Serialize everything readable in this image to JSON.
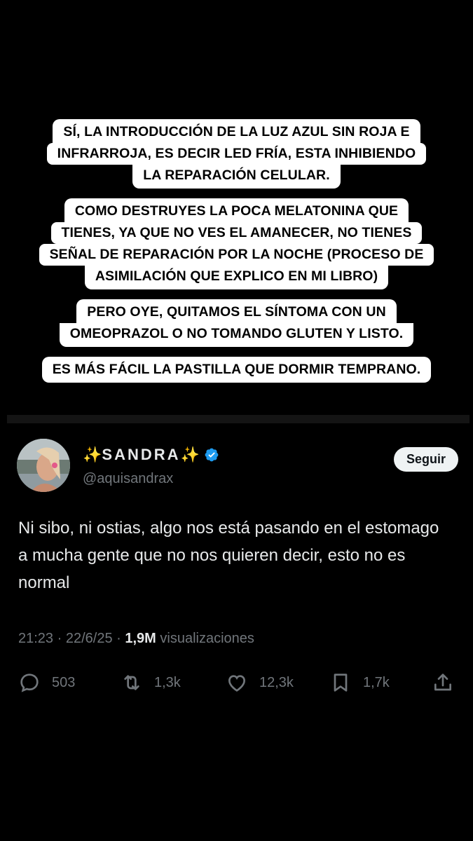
{
  "captions": [
    [
      "SÍ, LA INTRODUCCIÓN DE LA LUZ AZUL SIN ROJA E",
      "INFRARROJA, ES DECIR LED FRÍA, ESTA INHIBIENDO",
      "LA REPARACIÓN CELULAR."
    ],
    [
      "COMO DESTRUYES LA POCA MELATONINA QUE",
      "TIENES, YA QUE NO VES EL AMANECER, NO TIENES",
      "SEÑAL DE REPARACIÓN POR LA NOCHE (PROCESO DE",
      "ASIMILACIÓN QUE EXPLICO EN MI LIBRO)"
    ],
    [
      "PERO OYE, QUITAMOS EL SÍNTOMA CON UN",
      "OMEOPRAZOL O NO TOMANDO GLUTEN Y LISTO."
    ],
    [
      "ES MÁS FÁCIL LA PASTILLA QUE DORMIR TEMPRANO."
    ]
  ],
  "tweet": {
    "display_name_sparkle_left": "✨",
    "display_name": "SANDRA",
    "display_name_sparkle_right": "✨",
    "verified_icon": "verified-badge-icon",
    "handle": "@aquisandrax",
    "follow_label": "Seguir",
    "text": "Ni sibo, ni ostias, algo nos está pasando en el estomago a mucha gente que no nos quieren decir, esto no es normal",
    "time": "21:23",
    "date": "22/6/25",
    "views_count": "1,9M",
    "views_label": "visualizaciones",
    "replies": "503",
    "retweets": "1,3k",
    "likes": "12,3k",
    "bookmarks": "1,7k"
  },
  "colors": {
    "background": "#000000",
    "caption_bg": "#ffffff",
    "verified": "#1d9bf0",
    "muted_text": "#71767b"
  }
}
